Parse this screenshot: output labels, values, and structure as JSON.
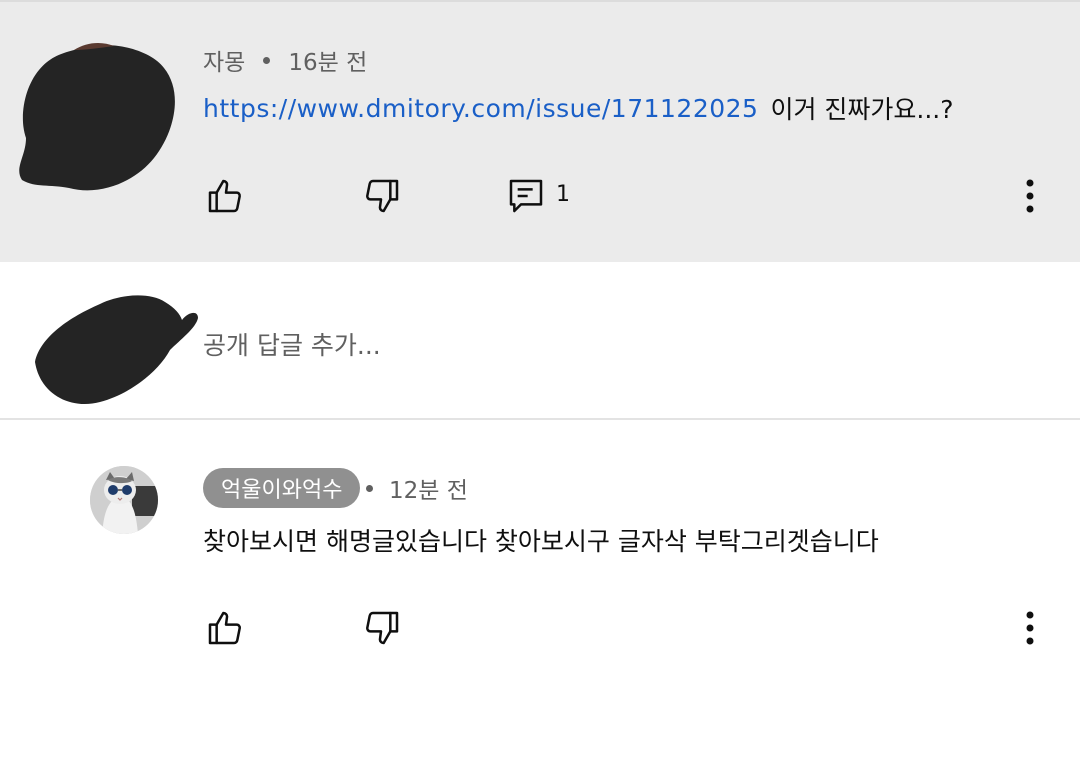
{
  "top_comment": {
    "author": "자몽",
    "time": "16분 전",
    "link": "https://www.dmitory.com/issue/171122025",
    "text": "이거 진짜가요...?",
    "reply_count": "1"
  },
  "reply_box": {
    "placeholder": "공개 답글 추가..."
  },
  "reply": {
    "author": "억울이와억수",
    "time": "12분 전",
    "text": "찾아보시면 해명글있습니다 찾아보시구 글자삭 부탁그리겟습니다"
  },
  "colors": {
    "highlight_bg": "#ebebeb",
    "link": "#1a5fc7",
    "badge_bg": "#909090",
    "meta_text": "#606060"
  },
  "icons": [
    "like-icon",
    "dislike-icon",
    "reply-icon",
    "more-vert-icon",
    "redaction-scribble"
  ]
}
